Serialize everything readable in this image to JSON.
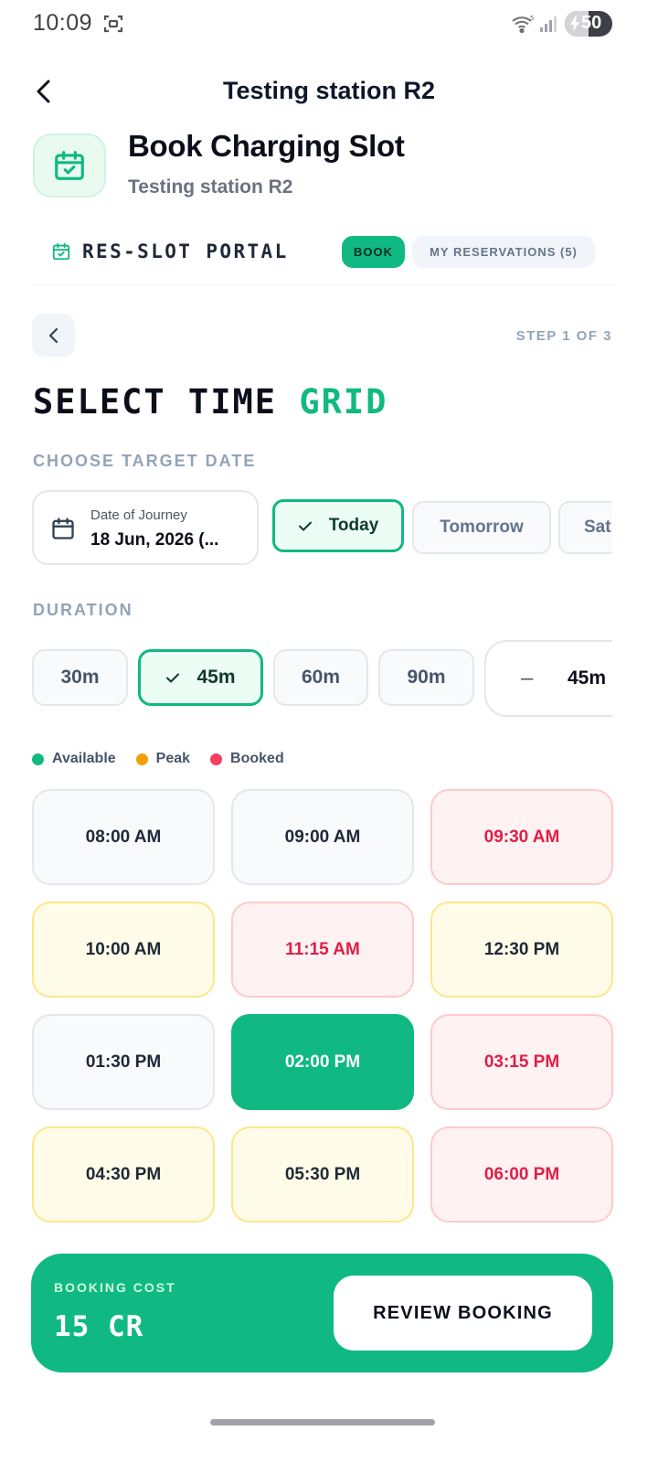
{
  "status_bar": {
    "time": "10:09",
    "battery_pct": "50",
    "battery_level": 0.5,
    "icons": [
      "screenshot-icon",
      "wifi-icon",
      "signal-icon",
      "battery-icon"
    ]
  },
  "header": {
    "title": "Testing station R2",
    "back_icon": "chevron-left-icon"
  },
  "station": {
    "title": "Book Charging Slot",
    "subtitle": "Testing station R2",
    "icon": "calendar-check-icon"
  },
  "portal": {
    "name": "RES-SLOT PORTAL",
    "tabs": [
      {
        "label": "BOOK",
        "active": true
      },
      {
        "label": "MY RESERVATIONS (5)",
        "active": false
      }
    ]
  },
  "step": {
    "label": "STEP 1 OF 3"
  },
  "section": {
    "title_main": "SELECT TIME ",
    "title_accent": "GRID"
  },
  "date": {
    "heading": "CHOOSE TARGET DATE",
    "field_label": "Date of Journey",
    "field_value": "18 Jun, 2026 (...",
    "options": [
      {
        "label": "Today",
        "selected": true
      },
      {
        "label": "Tomorrow",
        "selected": false
      },
      {
        "label": "Sat",
        "selected": false
      }
    ]
  },
  "duration": {
    "heading": "DURATION",
    "options": [
      {
        "label": "30m",
        "selected": false
      },
      {
        "label": "45m",
        "selected": true
      },
      {
        "label": "60m",
        "selected": false
      },
      {
        "label": "90m",
        "selected": false
      }
    ],
    "stepper_minus": "–",
    "stepper_value": "45m"
  },
  "legend": [
    {
      "label": "Available",
      "color": "#10b981"
    },
    {
      "label": "Peak",
      "color": "#f59e0b"
    },
    {
      "label": "Booked",
      "color": "#f43f5e"
    }
  ],
  "slots": [
    {
      "time": "08:00 AM",
      "state": "available"
    },
    {
      "time": "09:00 AM",
      "state": "available"
    },
    {
      "time": "09:30 AM",
      "state": "booked"
    },
    {
      "time": "10:00 AM",
      "state": "peak"
    },
    {
      "time": "11:15 AM",
      "state": "booked"
    },
    {
      "time": "12:30 PM",
      "state": "peak"
    },
    {
      "time": "01:30 PM",
      "state": "available"
    },
    {
      "time": "02:00 PM",
      "state": "selected"
    },
    {
      "time": "03:15 PM",
      "state": "booked"
    },
    {
      "time": "04:30 PM",
      "state": "peak"
    },
    {
      "time": "05:30 PM",
      "state": "peak"
    },
    {
      "time": "06:00 PM",
      "state": "booked"
    }
  ],
  "footer": {
    "cost_label": "BOOKING COST",
    "cost_value": "15 CR",
    "button_label": "REVIEW BOOKING"
  },
  "colors": {
    "accent": "#10b981",
    "peak": "#f59e0b",
    "booked": "#f43f5e"
  }
}
